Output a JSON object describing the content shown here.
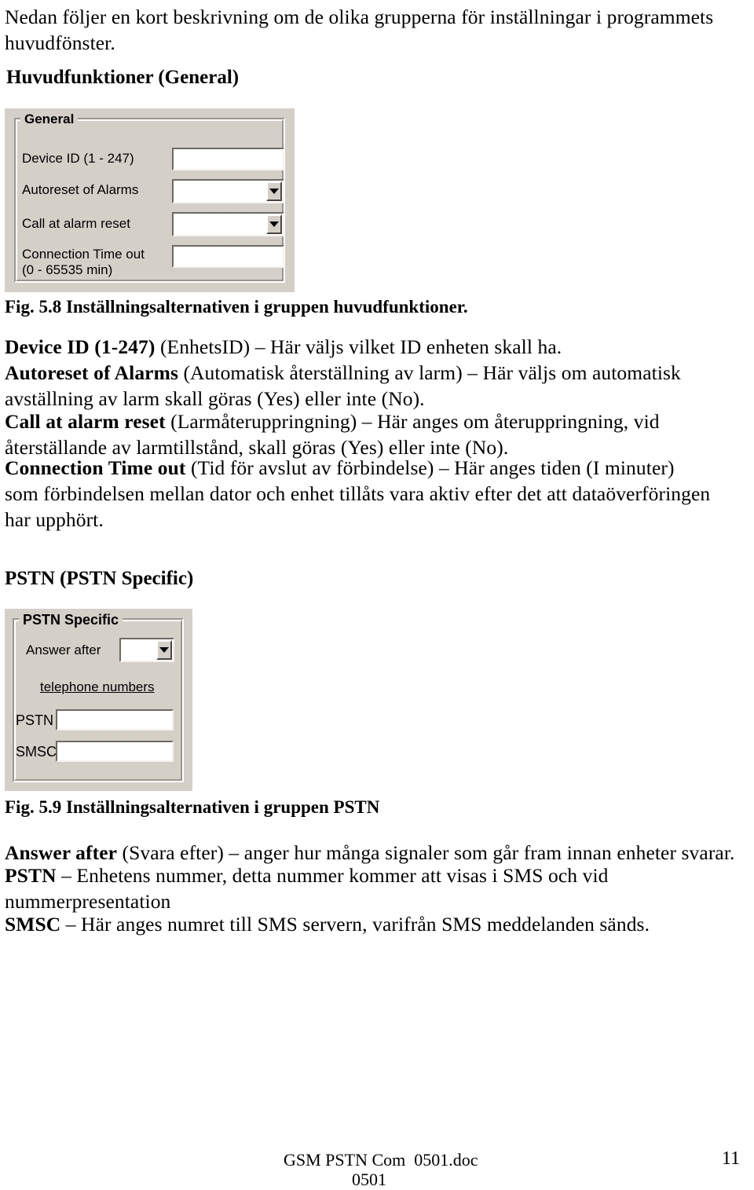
{
  "document": {
    "intro_paragraph": "Nedan följer en kort beskrivning om de olika grupperna för inställningar i programmets huvudfönster.",
    "section_general_heading": "Huvudfunktioner (General)",
    "figure_58_caption": "Fig. 5.8 Inställningsalternativen i gruppen huvudfunktioner.",
    "general_desc": {
      "device_id_term": "Device ID (1-247)",
      "device_id_text": " (EnhetsID) – Här väljs vilket ID enheten skall ha.",
      "autoreset_term": "Autoreset of Alarms",
      "autoreset_text": " (Automatisk återställning av larm) – Här väljs om automatisk avställning av larm skall göras (Yes) eller inte (No).",
      "call_at_alarm_term": "Call at alarm reset",
      "call_at_alarm_text": " (Larmåteruppringning) – Här anges om återuppringning, vid återställande av larmtillstånd, skall göras (Yes) eller inte (No).",
      "connection_timeout_term": "Connection Time out",
      "connection_timeout_text": " (Tid för avslut av förbindelse) – Här anges tiden (I minuter) som förbindelsen mellan dator och enhet tillåts vara aktiv efter det att dataöverföringen har upphört."
    },
    "section_pstn_heading": "PSTN (PSTN Specific)",
    "figure_59_caption": "Fig. 5.9 Inställningsalternativen i gruppen PSTN",
    "pstn_desc": {
      "answer_after_term": "Answer after",
      "answer_after_text": " (Svara efter) – anger hur många signaler som går fram innan enheter svarar.",
      "pstn_term": "PSTN",
      "pstn_text": " – Enhetens nummer, detta nummer kommer att visas i SMS och vid nummerpresentation",
      "smsc_term": "SMSC",
      "smsc_text": " – Här anges numret till SMS servern, varifrån SMS meddelanden sänds."
    },
    "footer": {
      "doc_name": "GSM PSTN Com  0501.doc",
      "sub_line": "0501",
      "page_number": "11"
    }
  },
  "general_dialog": {
    "group_legend": "General",
    "rows": [
      {
        "label": "Device ID (1 - 247)",
        "control": "textbox",
        "value": ""
      },
      {
        "label": "Autoreset of Alarms",
        "control": "combobox",
        "value": ""
      },
      {
        "label": "Call at alarm reset",
        "control": "combobox",
        "value": ""
      },
      {
        "label": "Connection Time out",
        "label2": "(0 - 65535 min)",
        "control": "textbox",
        "value": ""
      }
    ]
  },
  "pstn_dialog": {
    "group_legend": "PSTN Specific",
    "answer_after_label": "Answer after",
    "answer_after_value": "",
    "telephone_numbers_label": "telephone numbers",
    "pstn_label": "PSTN",
    "pstn_value": "",
    "smsc_label": "SMSC",
    "smsc_value": ""
  },
  "colors": {
    "dialog_face": "#d4d0c8",
    "field_bg": "#ffffff",
    "shadow": "#6e6a62",
    "highlight": "#ffffff",
    "text": "#000000"
  }
}
